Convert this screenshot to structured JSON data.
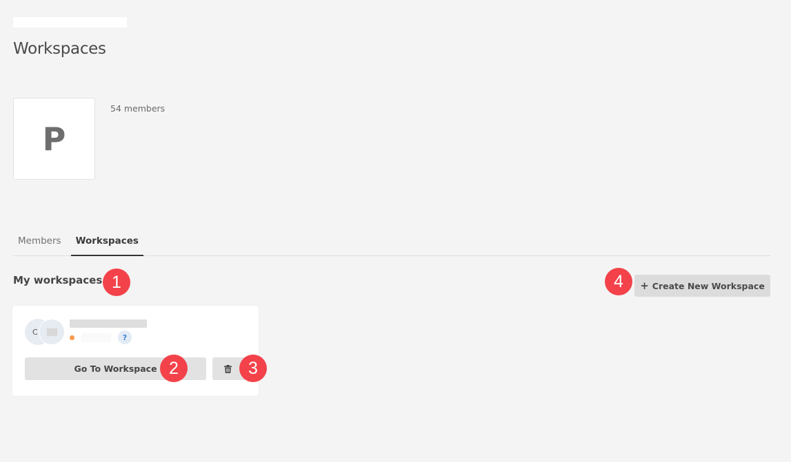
{
  "header": {
    "title": "Workspaces"
  },
  "organization": {
    "logo_letter": "P",
    "member_count": "54 members"
  },
  "tabs": [
    {
      "label": "Members",
      "active": false
    },
    {
      "label": "Workspaces",
      "active": true
    }
  ],
  "section": {
    "title": "My workspaces",
    "create_button_label": "Create New Workspace",
    "create_button_icon": "plus-icon"
  },
  "workspaces": [
    {
      "avatar_letter": "C",
      "status_color": "#f79a4c",
      "help_label": "?",
      "go_button_label": "Go To Workspace",
      "delete_icon": "trash-icon"
    }
  ],
  "annotations": {
    "badge_1": "1",
    "badge_2": "2",
    "badge_3": "3",
    "badge_4": "4",
    "badge_color": "#f3424a"
  }
}
